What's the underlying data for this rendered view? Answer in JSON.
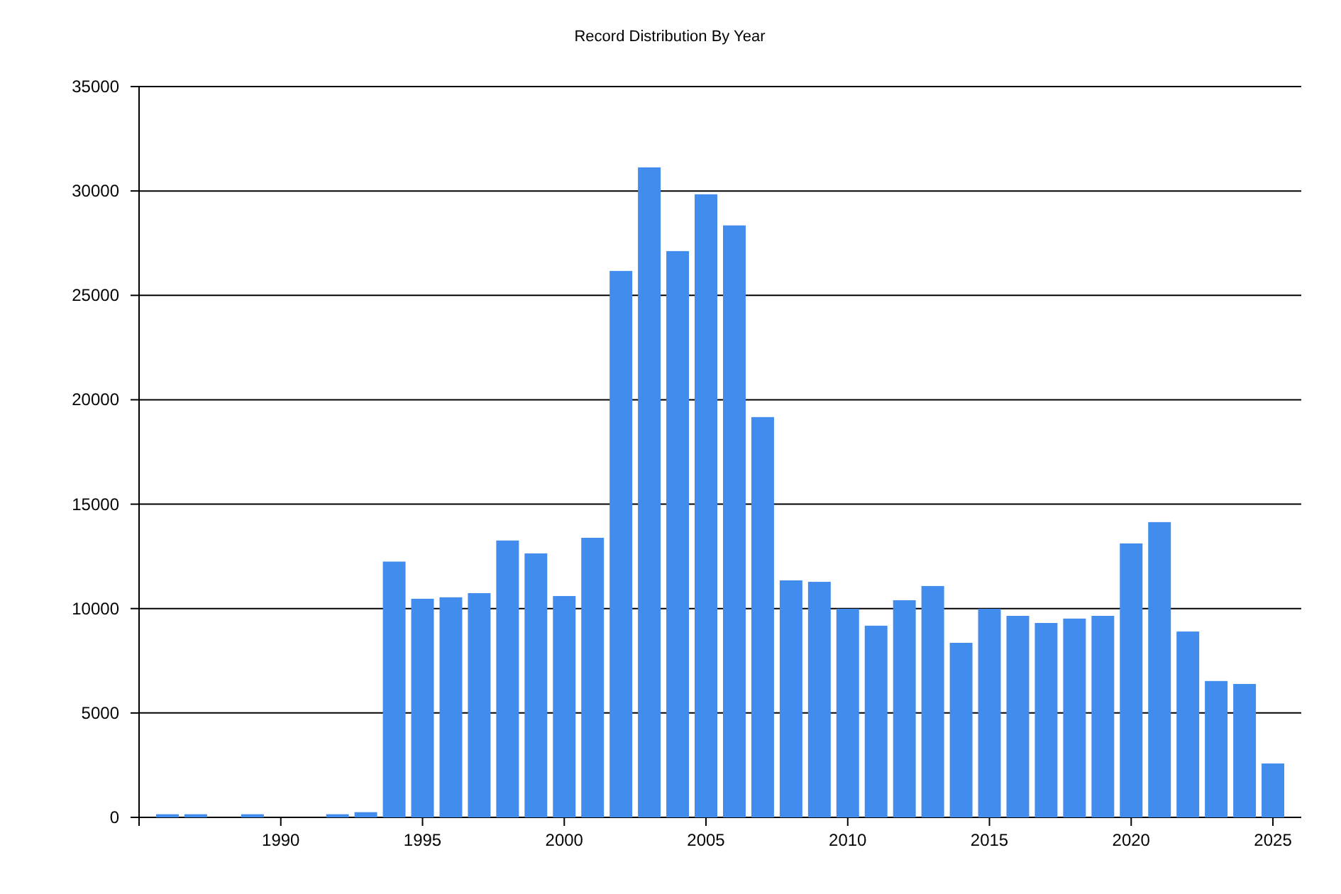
{
  "chart": {
    "chart_data": {
      "type": "bar",
      "title": "Record Distribution By Year",
      "x": [
        1986,
        1987,
        1989,
        1992,
        1993,
        1994,
        1995,
        1996,
        1997,
        1998,
        1999,
        2000,
        2001,
        2002,
        2003,
        2004,
        2005,
        2006,
        2007,
        2008,
        2009,
        2010,
        2011,
        2012,
        2013,
        2014,
        2015,
        2016,
        2017,
        2018,
        2019,
        2020,
        2021,
        2022,
        2023,
        2024,
        2025
      ],
      "values": [
        150,
        150,
        150,
        150,
        250,
        12250,
        10470,
        10540,
        10740,
        13260,
        12640,
        10600,
        13390,
        26170,
        31130,
        27120,
        29840,
        28350,
        19170,
        11350,
        11280,
        9990,
        9180,
        10400,
        11080,
        8360,
        9990,
        9650,
        9310,
        9520,
        9650,
        13120,
        14140,
        8900,
        6530,
        6390,
        2580
      ],
      "xlim": [
        1985,
        2026
      ],
      "ylim": [
        0,
        35000
      ],
      "xticks": [
        1990,
        1995,
        2000,
        2005,
        2010,
        2015,
        2020,
        2025
      ],
      "yticks": [
        0,
        5000,
        10000,
        15000,
        20000,
        25000,
        30000,
        35000
      ],
      "grid": true
    }
  }
}
